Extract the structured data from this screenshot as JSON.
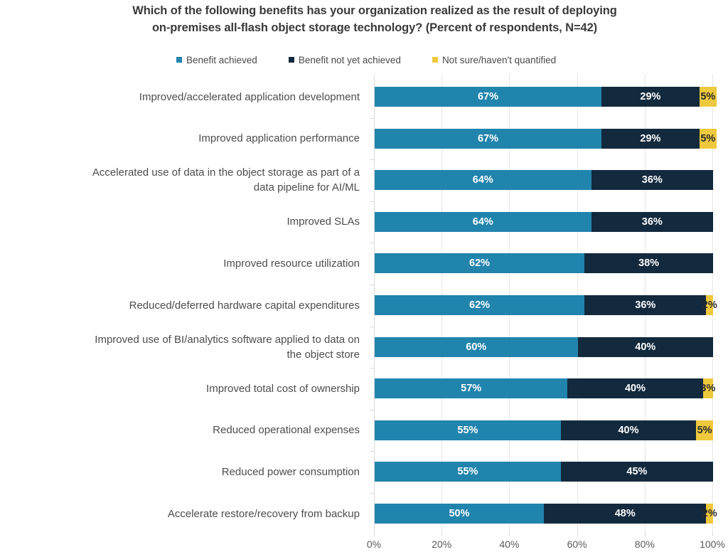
{
  "chart_data": {
    "type": "bar",
    "subtype": "horizontal-stacked-100",
    "title": "Which of the following benefits has your organization realized as the result of deploying on-premises all-flash object storage technology? (Percent of respondents, N=42)",
    "title_lines": [
      "Which of the following benefits has your organization realized as the result of deploying",
      "on-premises all-flash object storage technology? (Percent of respondents, N=42)"
    ],
    "xlabel": "",
    "ylabel": "",
    "xlim": [
      0,
      100
    ],
    "grid": true,
    "legend_position": "top",
    "sample_size": 42,
    "categories": [
      "Improved/accelerated application development",
      "Improved application performance",
      "Accelerated use of data in the object storage as part of a data pipeline for AI/ML",
      "Improved SLAs",
      "Improved resource utilization",
      "Reduced/deferred hardware capital expenditures",
      "Improved use of BI/analytics software applied to data on the object store",
      "Improved total cost of ownership",
      "Reduced operational expenses",
      "Reduced power consumption",
      "Accelerate restore/recovery from backup"
    ],
    "category_lines": [
      [
        "Improved/accelerated application development"
      ],
      [
        "Improved application performance"
      ],
      [
        "Accelerated use of data in the object storage as part of a",
        "data pipeline for AI/ML"
      ],
      [
        "Improved SLAs"
      ],
      [
        "Improved resource utilization"
      ],
      [
        "Reduced/deferred hardware capital expenditures"
      ],
      [
        "Improved use of BI/analytics software applied to data on",
        "the object store"
      ],
      [
        "Improved total cost of ownership"
      ],
      [
        "Reduced operational expenses"
      ],
      [
        "Reduced power consumption"
      ],
      [
        "Accelerate restore/recovery from backup"
      ]
    ],
    "series": [
      {
        "name": "Benefit achieved",
        "color": "#2184ad",
        "values": [
          67,
          67,
          64,
          64,
          62,
          62,
          60,
          57,
          55,
          55,
          50
        ],
        "labels": [
          "67%",
          "67%",
          "64%",
          "64%",
          "62%",
          "62%",
          "60%",
          "57%",
          "55%",
          "55%",
          "50%"
        ]
      },
      {
        "name": "Benefit not yet achieved",
        "color": "#13293d",
        "values": [
          29,
          29,
          36,
          36,
          38,
          36,
          40,
          40,
          40,
          45,
          48
        ],
        "labels": [
          "29%",
          "29%",
          "36%",
          "36%",
          "38%",
          "36%",
          "40%",
          "40%",
          "40%",
          "45%",
          "48%"
        ]
      },
      {
        "name": "Not sure/haven't quantified",
        "color": "#efc93d",
        "values": [
          5,
          5,
          0,
          0,
          0,
          2,
          0,
          3,
          5,
          0,
          2
        ],
        "labels": [
          "5%",
          "5%",
          "",
          "",
          "",
          "2%",
          "",
          "3%",
          "5%",
          "",
          "2%"
        ]
      }
    ],
    "x_ticks": [
      0,
      20,
      40,
      60,
      80,
      100
    ],
    "x_tick_labels": [
      "0%",
      "20%",
      "40%",
      "60%",
      "80%",
      "100%"
    ]
  },
  "legend": {
    "items": [
      {
        "label": "Benefit achieved",
        "color": "#2184ad",
        "marker": "square-marker-icon"
      },
      {
        "label": "Benefit not yet achieved",
        "color": "#13293d",
        "marker": "square-marker-icon"
      },
      {
        "label": "Not sure/haven't quantified",
        "color": "#efc93d",
        "marker": "square-marker-icon"
      }
    ]
  },
  "colors": {
    "achieved": "#2184ad",
    "not_yet_achieved": "#13293d",
    "not_sure": "#efc93d",
    "background": "#ffffff",
    "text": "#4d4d4d",
    "gridline": "#e6e6e6",
    "axis": "#d9d9d9"
  }
}
